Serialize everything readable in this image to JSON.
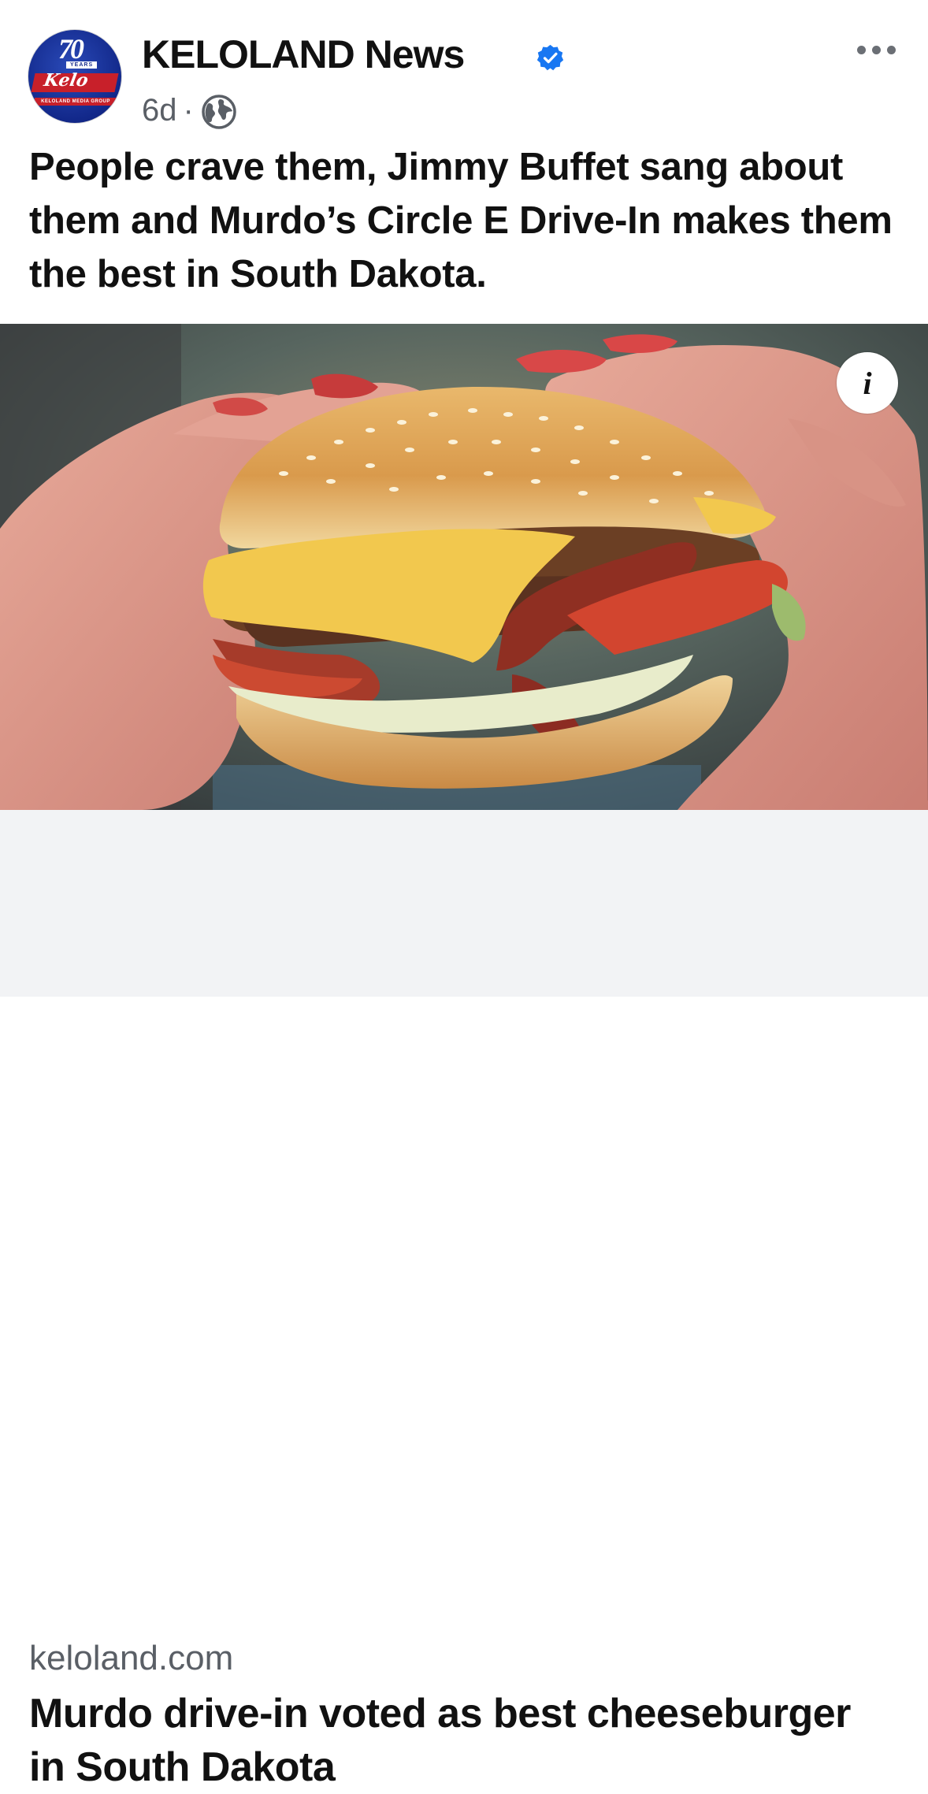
{
  "post": {
    "page_name": "KELOLAND News",
    "age": "6d",
    "separator": "·",
    "caption": "People crave them, Jimmy Buffet sang about them and Murdo’s Circle E Drive-In makes them the best in South Dakota.",
    "avatar": {
      "years_number": "70",
      "years_label": "YEARS",
      "brand": "Kelo",
      "group": "KELOLAND MEDIA GROUP"
    },
    "icons": {
      "verified": "verified-badge-icon",
      "audience": "globe-icon",
      "more": "more-options-icon",
      "info": "info-icon"
    },
    "info_glyph": "i"
  },
  "link_preview": {
    "domain": "keloland.com",
    "title": "Murdo drive-in voted as best cheeseburger in South Dakota"
  },
  "colors": {
    "verified": "#1877f2",
    "secondary_text": "#5a5f66",
    "link_background": "#f2f3f5",
    "brand_red": "#c8202a",
    "brand_blue": "#12288a"
  }
}
